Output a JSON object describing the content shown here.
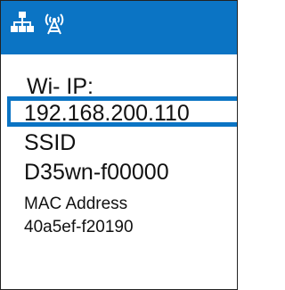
{
  "header": {
    "background_color": "#0b74c4",
    "icons": [
      "network-icon",
      "antenna-icon"
    ]
  },
  "network_info": {
    "wifi_ip_label": "Wi- IP:",
    "ip_address": "192.168.200.110",
    "ssid_label": "SSID",
    "ssid_value": "D35wn-f00000",
    "mac_label": "MAC Address",
    "mac_value": "40a5ef-f20190"
  },
  "selection": {
    "highlight_color": "#0b74c4"
  }
}
